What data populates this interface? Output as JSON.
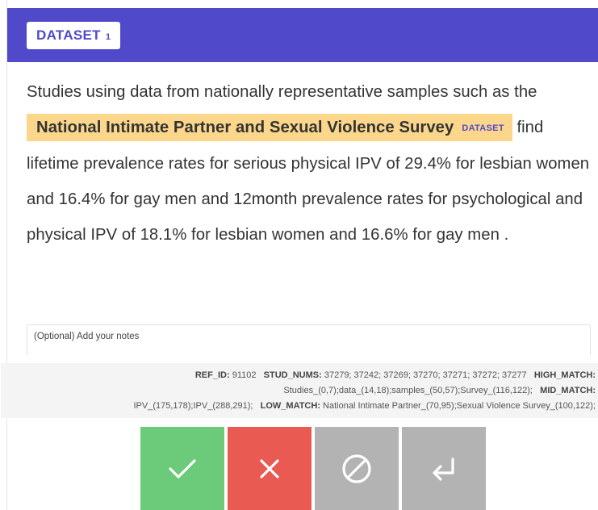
{
  "header": {
    "tag_label": "DATASET",
    "tag_number": "1"
  },
  "text": {
    "before": "Studies using data from nationally representative samples such as the",
    "highlight": "National Intimate Partner and Sexual Violence Survey",
    "highlight_label": "DATASET",
    "after": "find lifetime prevalence rates for serious physical IPV of 29.4% for lesbian women and 16.4% for gay men and 12month prevalence rates for psychological and physical IPV of 18.1% for lesbian women and 16.6% for gay men ."
  },
  "notes": {
    "placeholder": "(Optional) Add your notes"
  },
  "meta": {
    "ref_id_label": "REF_ID:",
    "ref_id": "91102",
    "stud_nums_label": "STUD_NUMS:",
    "stud_nums": "37279; 37242; 37269; 37270; 37271; 37272; 37277",
    "high_match_label": "HIGH_MATCH:",
    "high_match": "Studies_(0,7);data_(14,18);samples_(50,57);Survey_(116,122);",
    "mid_match_label": "MID_MATCH:",
    "mid_match": "IPV_(175,178);IPV_(288,291);",
    "low_match_label": "LOW_MATCH:",
    "low_match": "National Intimate Partner_(70,95);Sexual Violence Survey_(100,122);"
  },
  "actions": {
    "accept_icon": "check-icon",
    "reject_icon": "x-icon",
    "skip_icon": "ignore-icon",
    "undo_icon": "undo-icon"
  },
  "colors": {
    "header_bg": "#5049c9",
    "highlight_bg": "#fcd78b",
    "accept": "#6ccb7a",
    "reject": "#e85a52",
    "neutral": "#b3b3b3"
  }
}
